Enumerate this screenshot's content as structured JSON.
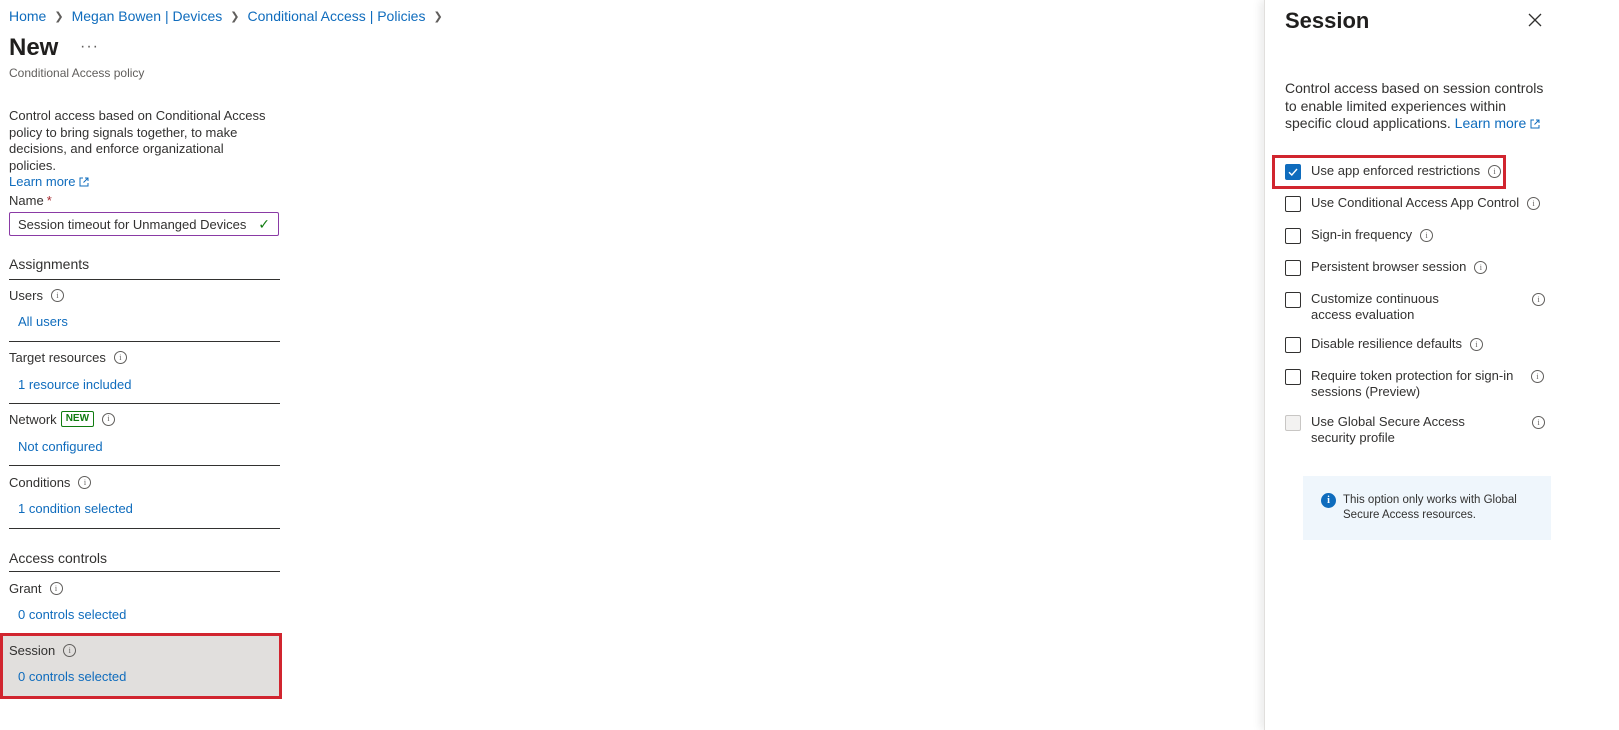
{
  "breadcrumb": [
    "Home",
    "Megan Bowen | Devices",
    "Conditional Access | Policies"
  ],
  "page": {
    "title": "New",
    "more": "···",
    "subtitle": "Conditional Access policy"
  },
  "intro": {
    "text": "Control access based on Conditional Access policy to bring signals together, to make decisions, and enforce organizational policies.",
    "learn_more": "Learn more"
  },
  "name_field": {
    "label": "Name",
    "required_mark": "*",
    "value": "Session timeout for Unmanged Devices"
  },
  "assignments": {
    "heading": "Assignments",
    "users": {
      "label": "Users",
      "value": "All users"
    },
    "target_resources": {
      "label": "Target resources",
      "value": "1 resource included"
    },
    "network": {
      "label": "Network",
      "badge": "NEW",
      "value": "Not configured"
    },
    "conditions": {
      "label": "Conditions",
      "value": "1 condition selected"
    }
  },
  "access_controls": {
    "heading": "Access controls",
    "grant": {
      "label": "Grant",
      "value": "0 controls selected"
    },
    "session": {
      "label": "Session",
      "value": "0 controls selected"
    }
  },
  "blade": {
    "title": "Session",
    "description": "Control access based on session controls to enable limited experiences within specific cloud applications.",
    "learn_more": "Learn more",
    "options": [
      {
        "label": "Use app enforced restrictions",
        "checked": true,
        "disabled": false
      },
      {
        "label": "Use Conditional Access App Control",
        "checked": false,
        "disabled": false
      },
      {
        "label": "Sign-in frequency",
        "checked": false,
        "disabled": false
      },
      {
        "label": "Persistent browser session",
        "checked": false,
        "disabled": false
      },
      {
        "label": "Customize continuous access evaluation",
        "checked": false,
        "disabled": false
      },
      {
        "label": "Disable resilience defaults",
        "checked": false,
        "disabled": false
      },
      {
        "label": "Require token protection for sign-in sessions (Preview)",
        "checked": false,
        "disabled": false
      },
      {
        "label": "Use Global Secure Access security profile",
        "checked": false,
        "disabled": true
      }
    ],
    "note": "This option only works with Global Secure Access resources."
  },
  "colors": {
    "link": "#0f6cbd",
    "highlight": "#d1252f",
    "session_row_bg": "#e1dfdd",
    "note_bg": "#eff6fc"
  }
}
